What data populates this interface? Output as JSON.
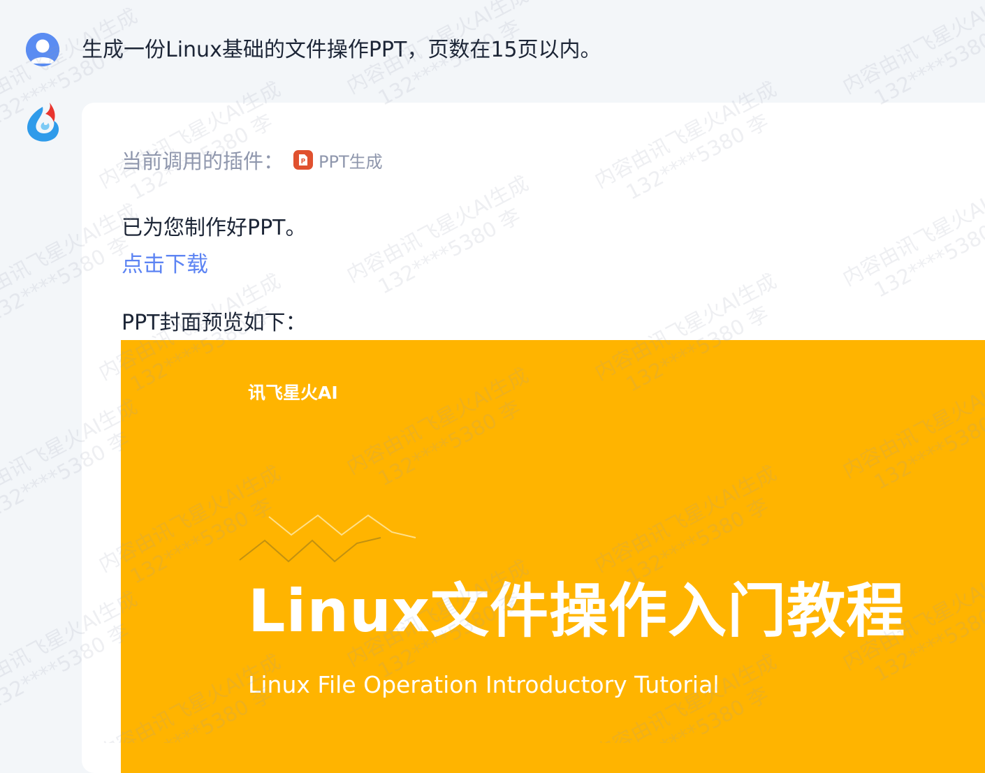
{
  "user_message": {
    "avatar_icon": "user-avatar-icon",
    "text": "生成一份Linux基础的文件操作PPT，页数在15页以内。"
  },
  "assistant": {
    "avatar_icon": "spark-logo-icon",
    "plugin_prefix": "当前调用的插件：",
    "plugin_icon": "ppt-file-icon",
    "plugin_name": "PPT生成",
    "reply_text": "已为您制作好PPT。",
    "download_link": "点击下载",
    "preview_label": "PPT封面预览如下："
  },
  "cover": {
    "brand": "讯飞星火AI",
    "title": "Linux文件操作入门教程",
    "subtitle": "Linux File Operation Introductory Tutorial",
    "background_color": "#ffb400"
  },
  "watermark": {
    "line1": "内容由讯飞星火AI生成",
    "line2": "132****5380 李"
  },
  "colors": {
    "page_background": "#f3f6f9",
    "card_background": "#ffffff",
    "link": "#5d84f3",
    "muted_text": "#8f97ad",
    "ppt_icon": "#e0512f"
  }
}
